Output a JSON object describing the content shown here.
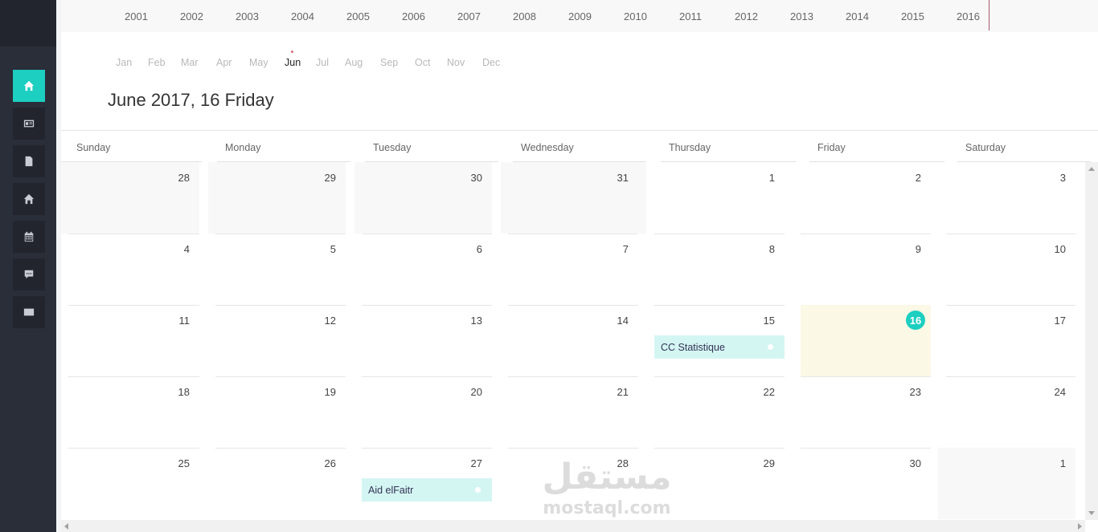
{
  "sidebar": {
    "items": [
      {
        "icon": "home-icon",
        "active": true
      },
      {
        "icon": "id-card-icon",
        "active": false
      },
      {
        "icon": "document-icon",
        "active": false
      },
      {
        "icon": "house-icon",
        "active": false
      },
      {
        "icon": "calendar-icon",
        "active": false
      },
      {
        "icon": "chat-icon",
        "active": false
      },
      {
        "icon": "envelope-icon",
        "active": false
      }
    ],
    "accent_color": "#1ccfc0"
  },
  "years": [
    "2001",
    "2002",
    "2003",
    "2004",
    "2005",
    "2006",
    "2007",
    "2008",
    "2009",
    "2010",
    "2011",
    "2012",
    "2013",
    "2014",
    "2015",
    "2016"
  ],
  "months": [
    "Jan",
    "Feb",
    "Mar",
    "Apr",
    "May",
    "Jun",
    "Jul",
    "Aug",
    "Sep",
    "Oct",
    "Nov",
    "Dec"
  ],
  "active_month": "Jun",
  "date_title": "June 2017, 16 Friday",
  "weekdays": [
    "Sunday",
    "Monday",
    "Tuesday",
    "Wednesday",
    "Thursday",
    "Friday",
    "Saturday"
  ],
  "weeks": [
    [
      {
        "day": "28",
        "muted": true
      },
      {
        "day": "29",
        "muted": true
      },
      {
        "day": "30",
        "muted": true
      },
      {
        "day": "31",
        "muted": true
      },
      {
        "day": "1"
      },
      {
        "day": "2"
      },
      {
        "day": "3"
      }
    ],
    [
      {
        "day": "4"
      },
      {
        "day": "5"
      },
      {
        "day": "6"
      },
      {
        "day": "7"
      },
      {
        "day": "8"
      },
      {
        "day": "9"
      },
      {
        "day": "10"
      }
    ],
    [
      {
        "day": "11"
      },
      {
        "day": "12"
      },
      {
        "day": "13"
      },
      {
        "day": "14"
      },
      {
        "day": "15",
        "event": "CC Statistique"
      },
      {
        "day": "16",
        "today": true
      },
      {
        "day": "17"
      }
    ],
    [
      {
        "day": "18"
      },
      {
        "day": "19"
      },
      {
        "day": "20"
      },
      {
        "day": "21"
      },
      {
        "day": "22"
      },
      {
        "day": "23"
      },
      {
        "day": "24"
      }
    ],
    [
      {
        "day": "25"
      },
      {
        "day": "26"
      },
      {
        "day": "27",
        "event": "Aid elFaitr"
      },
      {
        "day": "28"
      },
      {
        "day": "29"
      },
      {
        "day": "30"
      },
      {
        "day": "1",
        "muted": true
      }
    ]
  ],
  "today_color": "#fcf8e6",
  "event_color": "#d4f6f3",
  "watermark": {
    "arabic": "مستقل",
    "latin": "mostaql.com"
  }
}
